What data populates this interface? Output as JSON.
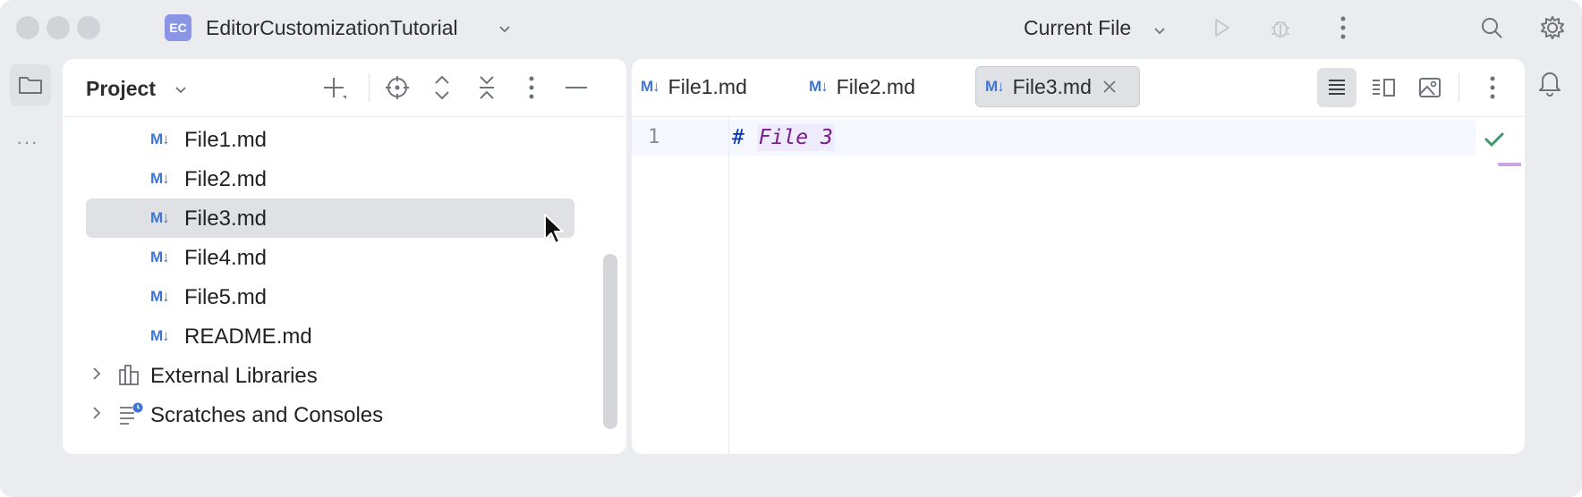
{
  "titlebar": {
    "project_badge": "EC",
    "project_name": "EditorCustomizationTutorial",
    "run_config": "Current File",
    "icons": [
      "run-icon",
      "debug-icon",
      "more-vertical-icon",
      "search-icon",
      "settings-gear-icon"
    ]
  },
  "left_stripe": {
    "items": [
      {
        "icon": "folder-icon"
      },
      {
        "icon": "more-horizontal-icon",
        "label": "···"
      }
    ]
  },
  "project_panel": {
    "title": "Project",
    "toolbar_icons": [
      "add-icon",
      "locate-icon",
      "expand-all-icon",
      "collapse-all-icon",
      "more-vertical-icon",
      "minimize-icon"
    ],
    "tree": [
      {
        "label": "File1.md",
        "icon": "M↓",
        "selected": false
      },
      {
        "label": "File2.md",
        "icon": "M↓",
        "selected": false
      },
      {
        "label": "File3.md",
        "icon": "M↓",
        "selected": true
      },
      {
        "label": "File4.md",
        "icon": "M↓",
        "selected": false
      },
      {
        "label": "File5.md",
        "icon": "M↓",
        "selected": false
      },
      {
        "label": "README.md",
        "icon": "M↓",
        "selected": false
      },
      {
        "label": "External Libraries",
        "icon": "library-icon",
        "expandable": true
      },
      {
        "label": "Scratches and Consoles",
        "icon": "scratches-icon",
        "expandable": true
      }
    ]
  },
  "editor": {
    "tabs": [
      {
        "label": "File1.md",
        "icon": "M↓",
        "active": false
      },
      {
        "label": "File2.md",
        "icon": "M↓",
        "active": false
      },
      {
        "label": "File3.md",
        "icon": "M↓",
        "active": true,
        "closable": true
      }
    ],
    "view_modes": [
      "editor-only-icon",
      "split-view-icon",
      "preview-only-icon"
    ],
    "active_view_mode": "editor-only-icon",
    "lines": [
      {
        "number": "1",
        "hash": "#",
        "text": "File 3"
      }
    ],
    "inspection_status": "ok-check-icon"
  },
  "right_stripe": {
    "icon": "notifications-bell-icon"
  },
  "colors": {
    "accent": "#3f74d9",
    "selection": "#dfe1e5",
    "window_bg": "#ebecf0",
    "heading_text": "#7a1b86",
    "check": "#3e9a6e"
  }
}
